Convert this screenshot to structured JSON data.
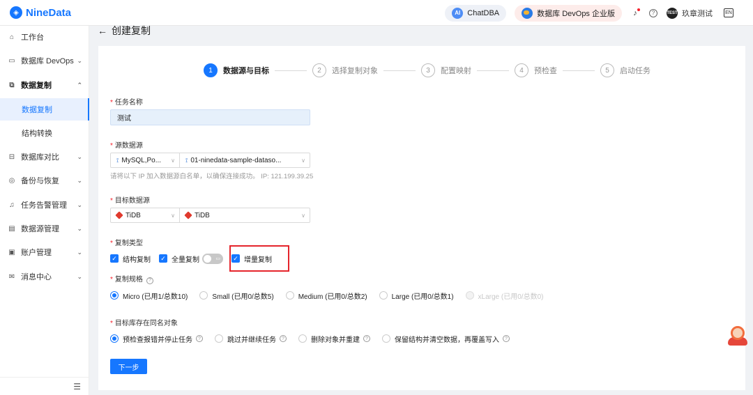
{
  "app": {
    "brand": "NineData"
  },
  "topbar": {
    "chat_label": "ChatDBA",
    "chat_badge": "AI",
    "enterprise_label": "数据库 DevOps 企业版",
    "avatar_text": "TEST",
    "username": "玖章测试",
    "lang_icon_text": "EN"
  },
  "sidebar": {
    "items": [
      {
        "label": "工作台",
        "icon": "home-icon",
        "glyph": "⌂"
      },
      {
        "label": "数据库 DevOps",
        "icon": "devops-icon",
        "glyph": "▭"
      },
      {
        "label": "数据复制",
        "icon": "replication-icon",
        "glyph": "⧉"
      },
      {
        "label": "数据复制"
      },
      {
        "label": "结构转换"
      },
      {
        "label": "数据库对比",
        "icon": "compare-icon",
        "glyph": "⊟"
      },
      {
        "label": "备份与恢复",
        "icon": "backup-icon",
        "glyph": "◎"
      },
      {
        "label": "任务告警管理",
        "icon": "alarm-icon",
        "glyph": "♫"
      },
      {
        "label": "数据源管理",
        "icon": "datasource-icon",
        "glyph": "▤"
      },
      {
        "label": "账户管理",
        "icon": "account-icon",
        "glyph": "▣"
      },
      {
        "label": "消息中心",
        "icon": "message-icon",
        "glyph": "✉"
      }
    ],
    "collapse_glyph": "☰"
  },
  "page": {
    "title": "创建复制",
    "steps": [
      {
        "num": "1",
        "label": "数据源与目标"
      },
      {
        "num": "2",
        "label": "选择复制对象"
      },
      {
        "num": "3",
        "label": "配置映射"
      },
      {
        "num": "4",
        "label": "预检查"
      },
      {
        "num": "5",
        "label": "启动任务"
      }
    ]
  },
  "form": {
    "task_name_label": "任务名称",
    "task_name_value": "测试",
    "source_label": "源数据源",
    "source_type": "MySQL,Po...",
    "source_instance": "01-ninedata-sample-dataso...",
    "whitelist_hint": "请将以下 IP 加入数据源白名单，以确保连接成功。 IP: 121.199.39.25",
    "target_label": "目标数据源",
    "target_type": "TiDB",
    "target_instance": "TiDB",
    "copy_type_label": "复制类型",
    "copy_types": [
      "结构复制",
      "全量复制",
      "增量复制"
    ],
    "spec_label": "复制规格",
    "specs": [
      "Micro (已用1/总数10)",
      "Small (已用0/总数5)",
      "Medium (已用0/总数2)",
      "Large (已用0/总数1)",
      "xLarge (已用0/总数0)"
    ],
    "conflict_label": "目标库存在同名对象",
    "conflict_options": [
      "预检查报错并停止任务",
      "跳过并继续任务",
      "删除对象并重建",
      "保留结构并清空数据，再覆盖写入"
    ],
    "next_label": "下一步"
  },
  "colors": {
    "primary": "#1677ff",
    "highlight_box": "#e5242b"
  }
}
